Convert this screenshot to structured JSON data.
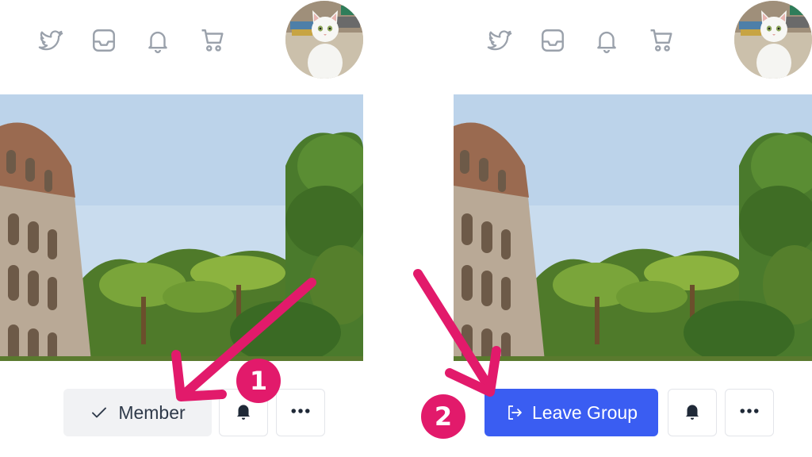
{
  "panels": [
    {
      "step": "1",
      "nav_icons": [
        "twitter-icon",
        "inbox-icon",
        "bell-icon",
        "cart-icon"
      ],
      "membership_button": {
        "label": "Member",
        "icon": "check-icon"
      },
      "notify_button": {
        "icon": "bell-icon"
      },
      "more_button": {
        "icon": "more-horizontal-icon"
      }
    },
    {
      "step": "2",
      "nav_icons": [
        "twitter-icon",
        "inbox-icon",
        "bell-icon",
        "cart-icon"
      ],
      "membership_button": {
        "label": "Leave Group",
        "icon": "leave-icon"
      },
      "notify_button": {
        "icon": "bell-icon"
      },
      "more_button": {
        "icon": "more-horizontal-icon"
      }
    }
  ],
  "colors": {
    "annotation": "#e21a6b",
    "primary": "#3a5df2",
    "icon_gray": "#9aa1ab",
    "text_dark": "#2f3a4a"
  }
}
